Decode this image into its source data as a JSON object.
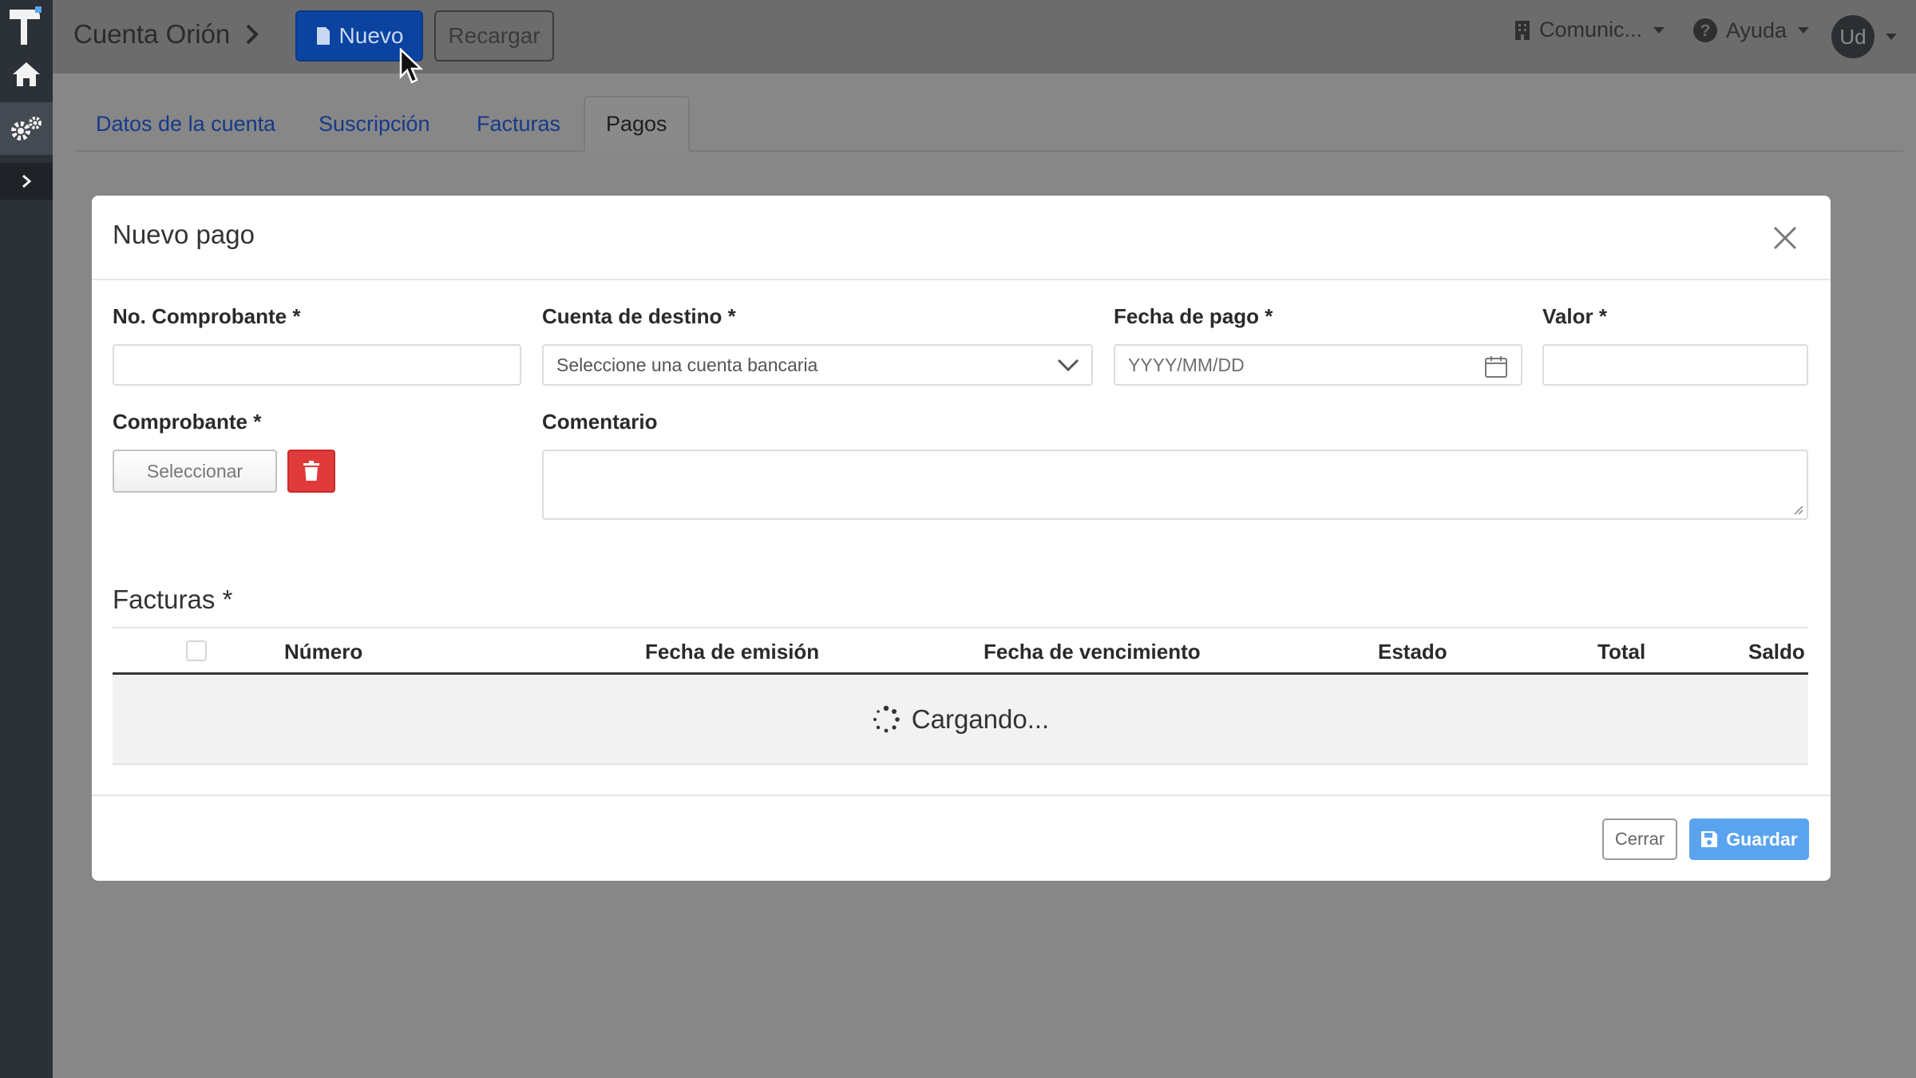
{
  "header": {
    "account_name": "Cuenta Orión",
    "new_label": "Nuevo",
    "reload_label": "Recargar",
    "company_menu": "Comunic...",
    "help_menu": "Ayuda",
    "user_initials": "Ud"
  },
  "tabs": [
    {
      "label": "Datos de la cuenta",
      "active": false
    },
    {
      "label": "Suscripción",
      "active": false
    },
    {
      "label": "Facturas",
      "active": false
    },
    {
      "label": "Pagos",
      "active": true
    }
  ],
  "modal": {
    "title": "Nuevo pago",
    "fields": {
      "receipt_number_label": "No. Comprobante *",
      "receipt_number_value": "",
      "destination_account_label": "Cuenta de destino *",
      "destination_account_placeholder": "Seleccione una cuenta bancaria",
      "payment_date_label": "Fecha de pago *",
      "payment_date_placeholder": "YYYY/MM/DD",
      "amount_label": "Valor *",
      "amount_value": "",
      "receipt_label": "Comprobante *",
      "select_file_label": "Seleccionar",
      "comment_label": "Comentario",
      "comment_value": ""
    },
    "invoices": {
      "title": "Facturas",
      "required_mark": "*",
      "columns": [
        "Número",
        "Fecha de emisión",
        "Fecha de vencimiento",
        "Estado",
        "Total",
        "Saldo"
      ],
      "loading_text": "Cargando..."
    },
    "footer": {
      "close_label": "Cerrar",
      "save_label": "Guardar"
    }
  },
  "colors": {
    "primary": "#0b43a0",
    "save_button": "#5aa4ef",
    "danger": "#e03a3a",
    "sidebar": "#2c3137",
    "overlay_background": "#878787"
  },
  "icons": [
    "logo-icon",
    "home-icon",
    "settings-icon",
    "chevron-right-icon",
    "document-icon",
    "building-icon",
    "help-icon",
    "close-icon",
    "chevron-down-icon",
    "calendar-icon",
    "trash-icon",
    "spinner-icon",
    "save-icon",
    "mouse-cursor-icon"
  ]
}
